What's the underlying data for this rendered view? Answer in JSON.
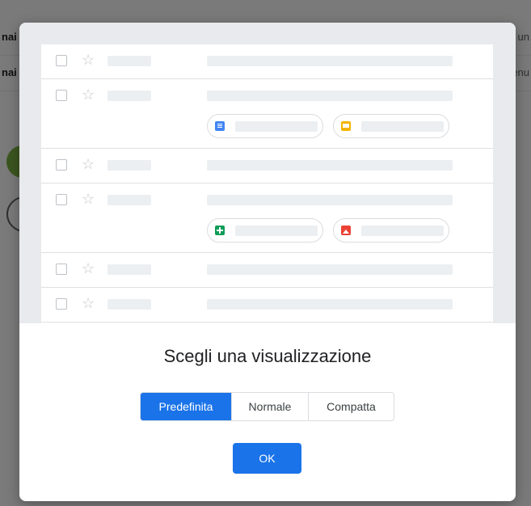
{
  "background": {
    "row1_left_text": "nai",
    "row1_right_text": "un",
    "row2_left_text": "nai",
    "row2_right_text": "enu"
  },
  "preview": {
    "rows": [
      {
        "kind": "single"
      },
      {
        "kind": "double",
        "attachments": [
          "doc-icon",
          "slides-icon"
        ]
      },
      {
        "kind": "single"
      },
      {
        "kind": "double",
        "attachments": [
          "sheets-icon",
          "image-icon"
        ]
      },
      {
        "kind": "single"
      },
      {
        "kind": "single"
      }
    ]
  },
  "dialog": {
    "title": "Scegli una visualizzazione",
    "options": [
      "Predefinita",
      "Normale",
      "Compatta"
    ],
    "selected": "Predefinita",
    "ok_label": "OK"
  },
  "colors": {
    "accent": "#1a73e8",
    "doc": "#4285f4",
    "slides": "#f4b400",
    "sheets": "#0f9d58",
    "image": "#ea4335"
  }
}
